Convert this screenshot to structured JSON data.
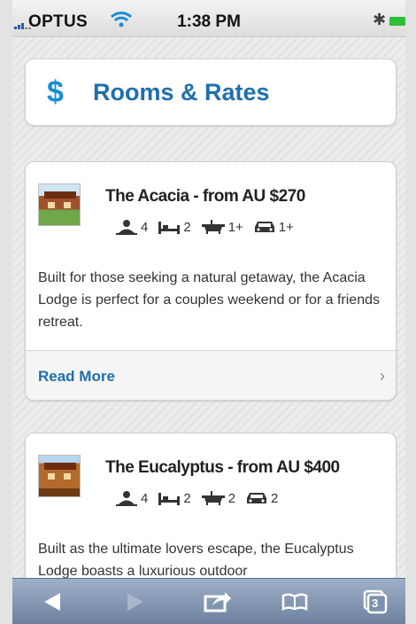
{
  "status_bar": {
    "carrier": "OPTUS",
    "time": "1:38 PM"
  },
  "header": {
    "icon": "dollar-icon",
    "title": "Rooms & Rates"
  },
  "rooms": [
    {
      "title": "The Acacia - from AU $270",
      "guests": "4",
      "beds": "2",
      "baths": "1+",
      "cars": "1+",
      "description": "Built for those seeking a natural getaway, the Acacia Lodge is perfect for a couples weekend or for a friends retreat.",
      "read_more": "Read More"
    },
    {
      "title": "The Eucalyptus - from AU $400",
      "guests": "4",
      "beds": "2",
      "baths": "2",
      "cars": "2",
      "description": "Built as the ultimate lovers escape, the Eucalyptus Lodge boasts a luxurious outdoor"
    }
  ],
  "toolbar": {
    "tabs_count": "3"
  },
  "colors": {
    "accent": "#1f6fae",
    "dollar": "#1a8ed6",
    "toolbar": "#7d90ad"
  }
}
